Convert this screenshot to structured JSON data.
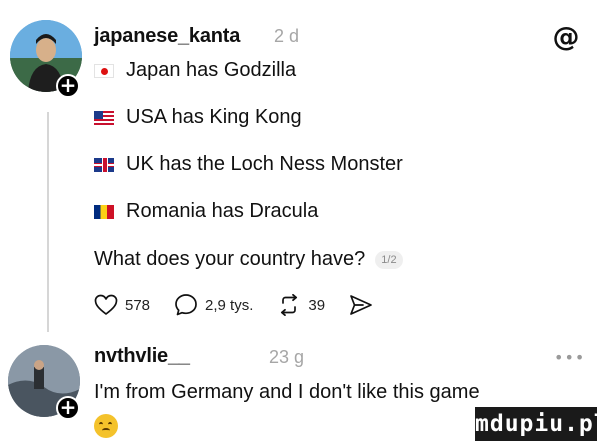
{
  "post": {
    "username": "japanese_kanta",
    "time": "2 d",
    "lines": [
      {
        "flag": "japan-flag",
        "text": "Japan has Godzilla"
      },
      {
        "flag": "usa-flag",
        "text": "USA has King Kong"
      },
      {
        "flag": "uk-flag",
        "text": "UK has the Loch Ness Monster"
      },
      {
        "flag": "romania-flag",
        "text": "Romania has Dracula"
      }
    ],
    "question": "What does your country have?",
    "counter": "1/2",
    "likes": "578",
    "replies": "2,9 tys.",
    "reposts": "39"
  },
  "reply": {
    "username": "nvthvlie__",
    "time": "23 g",
    "more": "•••",
    "text": "I'm from Germany and I don't like this game",
    "emoji": "weary-face-emoji"
  },
  "icons": {
    "threads_logo": "@",
    "plus": "+"
  },
  "watermark": "mdupiu.pl",
  "colors": {
    "text": "#111111",
    "muted": "#a6a6a6",
    "thread_line": "#d6d6d6"
  }
}
